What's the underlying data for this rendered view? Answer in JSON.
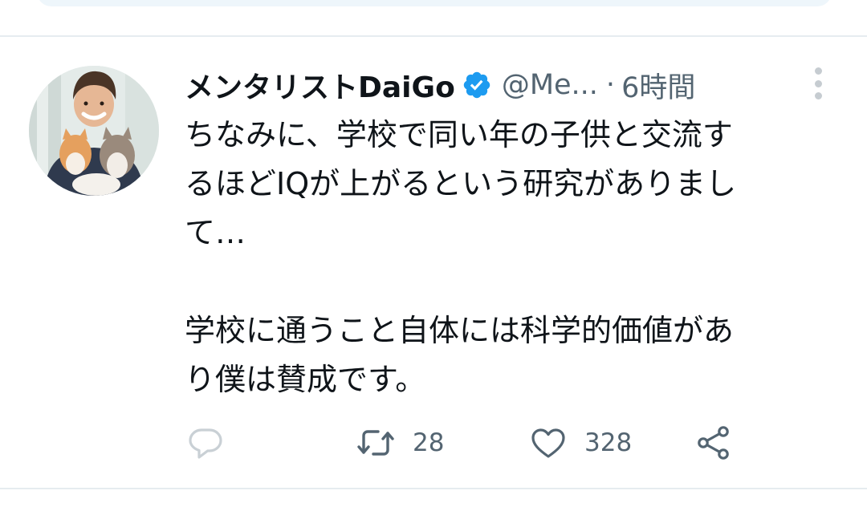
{
  "tweet": {
    "author_name": "メンタリストDaiGo",
    "handle": "@Me...",
    "separator": "·",
    "time": "6時間",
    "verified": true,
    "text_lines": [
      "ちなみに、学校で同い年の子供と交流す",
      "るほどIQが上がるという研究がありまし",
      "て…",
      "",
      "学校に通うこと自体には科学的価値があ",
      "り僕は賛成です。"
    ],
    "actions": {
      "reply_count": "",
      "retweet_count": "28",
      "like_count": "328"
    }
  },
  "colors": {
    "verified_blue": "#1d9bf0",
    "muted_text": "#536471",
    "divider": "#e6ecf0"
  },
  "icons": [
    "verified-badge-icon",
    "more-options-icon",
    "reply-icon",
    "retweet-icon",
    "like-icon",
    "share-icon"
  ]
}
